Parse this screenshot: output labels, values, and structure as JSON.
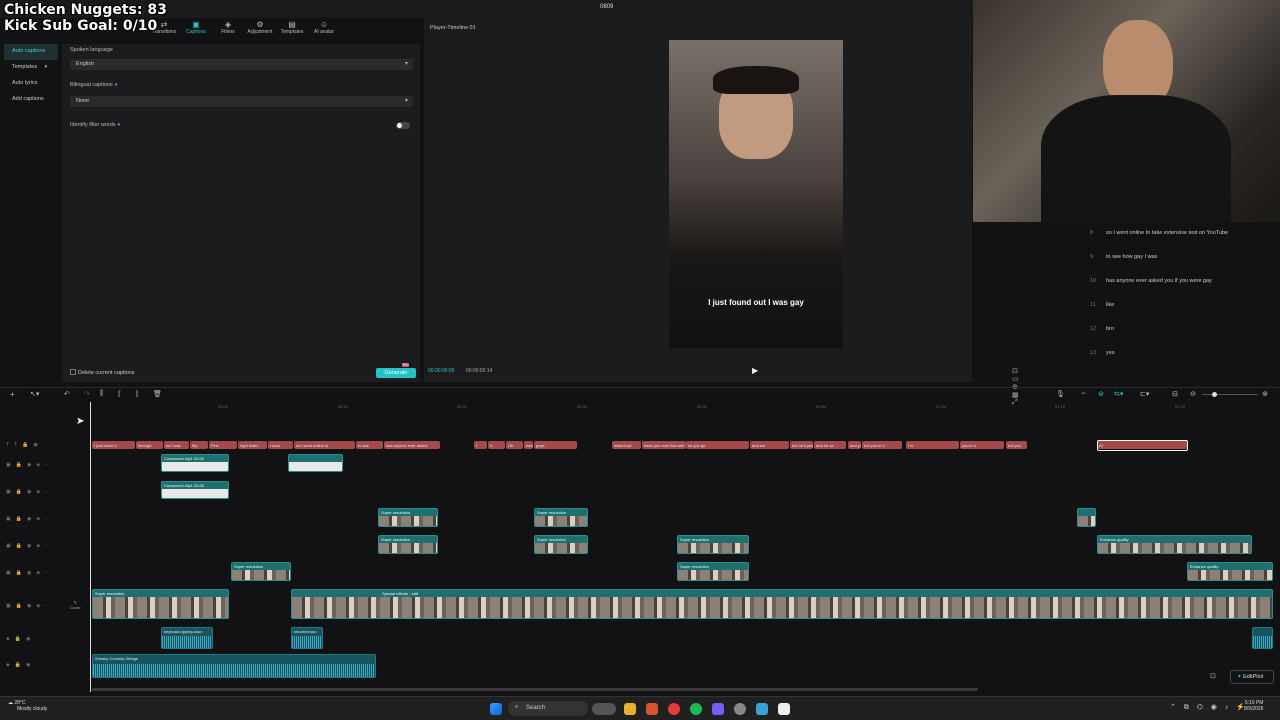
{
  "window": {
    "title": "0809"
  },
  "overlay": {
    "line1": "Chicken Nuggets: 83",
    "line2": "Kick Sub Goal: 0/10"
  },
  "toolbar": {
    "items": [
      {
        "label": "Transitions",
        "icon": "transitions-icon"
      },
      {
        "label": "Captions",
        "icon": "captions-icon",
        "active": true
      },
      {
        "label": "Filters",
        "icon": "filters-icon"
      },
      {
        "label": "Adjustment",
        "icon": "adjustment-icon"
      },
      {
        "label": "Templates",
        "icon": "templates-icon"
      },
      {
        "label": "AI avatar",
        "icon": "ai-avatar-icon"
      }
    ]
  },
  "leftnav": {
    "items": [
      {
        "label": "Auto captions",
        "active": true
      },
      {
        "label": "Templates"
      },
      {
        "label": "Auto lyrics"
      },
      {
        "label": "Add captions"
      }
    ]
  },
  "captions_panel": {
    "spoken_language_label": "Spoken language",
    "spoken_language_value": "English",
    "bilingual_label": "Bilingual captions",
    "bilingual_value": "None",
    "filler_label": "Identify filler words",
    "delete_label": "Delete current captions",
    "generate_label": "Generate",
    "generate_badge": "Pro"
  },
  "player": {
    "title": "Player-Timeline 01",
    "current_time": "00:00:00:00",
    "total_time": "00:00:50:14",
    "subtitle": "I just found out I was gay"
  },
  "caption_list": [
    {
      "n": "8",
      "text": "so I went online to take extensive test on YouTube"
    },
    {
      "n": "9",
      "text": "to see how gay I was"
    },
    {
      "n": "10",
      "text": "has anyone ever asked you if you were gay"
    },
    {
      "n": "11",
      "text": "like"
    },
    {
      "n": "12",
      "text": "bro"
    },
    {
      "n": "13",
      "text": "yes"
    }
  ],
  "timeline": {
    "ruler": [
      "00:00",
      "00:10",
      "00:20",
      "00:30",
      "00:40",
      "00:50",
      "01:00",
      "01:10",
      "01:20",
      "01:30",
      "01:40"
    ],
    "caption_clips": [
      "I just found o",
      "through",
      "so I was",
      "My",
      "Fine",
      "right when",
      "I foun",
      "so I went online to",
      "to see",
      "has anyone ever asked",
      "I",
      "It",
      "OK",
      "have you ever",
      "guys",
      "what if we",
      "have you ever fwd aim",
      "so you go",
      "and we",
      "bot he's just",
      "and he sa",
      "and you got a sec",
      "but you're n",
      "I w",
      "you're s",
      "but you",
      "AI"
    ],
    "video_labels": {
      "compound": "Compound clip1  00:00",
      "super_res": "Super resolution",
      "enhance": "Enhance quality",
      "special": "Special effects - edit"
    },
    "audio_clips": [
      "keyboard-typing-soun",
      "shocked sou",
      "Sneaky Comedy Strings"
    ],
    "cover_label": "Cover"
  },
  "editpilot": {
    "label": "EditPilot"
  },
  "taskbar": {
    "weather_temp": "28°C",
    "weather_desc": "Mostly cloudy",
    "search_label": "Search",
    "time": "5:10 PM",
    "date": "8/9/2026"
  },
  "colors": {
    "accent": "#2ec4cf",
    "caption_clip": "#a34a4a",
    "video_clip": "#1f6f6e"
  }
}
